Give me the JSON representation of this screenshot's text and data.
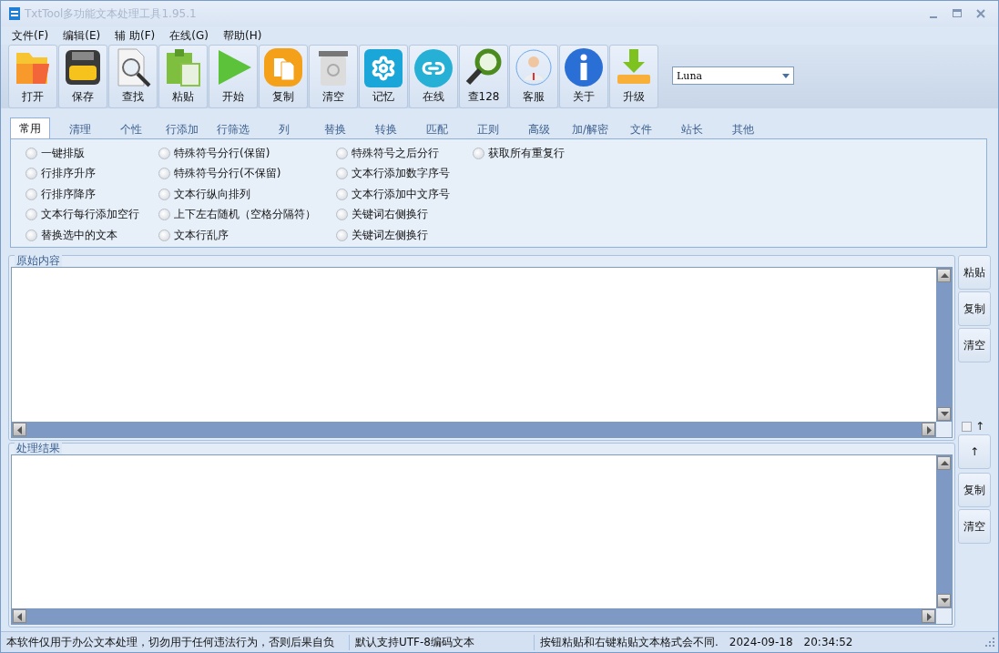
{
  "window": {
    "title": "TxtTool多功能文本处理工具1.95.1"
  },
  "menu": [
    "文件(F)",
    "编辑(E)",
    "辅 助(F)",
    "在线(G)",
    "帮助(H)"
  ],
  "toolbar": [
    {
      "kind": "open",
      "label": "打开"
    },
    {
      "kind": "save",
      "label": "保存"
    },
    {
      "kind": "find",
      "label": "查找"
    },
    {
      "kind": "paste",
      "label": "粘贴"
    },
    {
      "kind": "start",
      "label": "开始"
    },
    {
      "kind": "copy",
      "label": "复制"
    },
    {
      "kind": "clear",
      "label": "清空"
    },
    {
      "kind": "memory",
      "label": "记忆"
    },
    {
      "kind": "online",
      "label": "在线"
    },
    {
      "kind": "lookup",
      "label": "查128"
    },
    {
      "kind": "service",
      "label": "客服"
    },
    {
      "kind": "about",
      "label": "关于"
    },
    {
      "kind": "upgrade",
      "label": "升级"
    }
  ],
  "theme_select": {
    "value": "Luna"
  },
  "tabs": [
    {
      "label": "常用",
      "selected": true
    },
    {
      "label": "清理",
      "selected": false
    },
    {
      "label": "个性",
      "selected": false
    },
    {
      "label": "行添加",
      "selected": false
    },
    {
      "label": "行筛选",
      "selected": false
    },
    {
      "label": "列",
      "selected": false
    },
    {
      "label": "替换",
      "selected": false
    },
    {
      "label": "转换",
      "selected": false
    },
    {
      "label": "匹配",
      "selected": false
    },
    {
      "label": "正则",
      "selected": false
    },
    {
      "label": "高级",
      "selected": false
    },
    {
      "label": "加/解密",
      "selected": false
    },
    {
      "label": "文件",
      "selected": false
    },
    {
      "label": "站长",
      "selected": false
    },
    {
      "label": "其他",
      "selected": false
    }
  ],
  "option_columns": [
    [
      {
        "label": "一键排版",
        "selected": false
      },
      {
        "label": "行排序升序",
        "selected": false
      },
      {
        "label": "行排序降序",
        "selected": false
      },
      {
        "label": "文本行每行添加空行",
        "selected": false
      },
      {
        "label": "替换选中的文本",
        "selected": false
      }
    ],
    [
      {
        "label": "特殊符号分行(保留)",
        "selected": false
      },
      {
        "label": "特殊符号分行(不保留)",
        "selected": false
      },
      {
        "label": "文本行纵向排列",
        "selected": false
      },
      {
        "label": "上下左右随机（空格分隔符）",
        "selected": false
      },
      {
        "label": "文本行乱序",
        "selected": false
      }
    ],
    [
      {
        "label": "特殊符号之后分行",
        "selected": false
      },
      {
        "label": "文本行添加数字序号",
        "selected": false
      },
      {
        "label": "文本行添加中文序号",
        "selected": false
      },
      {
        "label": "关键词右侧换行",
        "selected": false
      },
      {
        "label": "关键词左侧换行",
        "selected": false
      }
    ],
    [
      {
        "label": "获取所有重复行",
        "selected": false
      }
    ]
  ],
  "source_panel": {
    "title": "原始内容",
    "buttons": [
      "粘贴",
      "复制",
      "清空"
    ]
  },
  "swap": {
    "checked": false,
    "label": "↑",
    "button": "↑"
  },
  "result_panel": {
    "title": "处理结果",
    "buttons": [
      "复制",
      "清空"
    ]
  },
  "status_bar": [
    "本软件仅用于办公文本处理，切勿用于任何违法行为，否则后果自负",
    "默认支持UTF-8编码文本",
    "按钮粘贴和右键粘贴文本格式会不同.",
    "2024-09-18",
    "20:34:52"
  ]
}
